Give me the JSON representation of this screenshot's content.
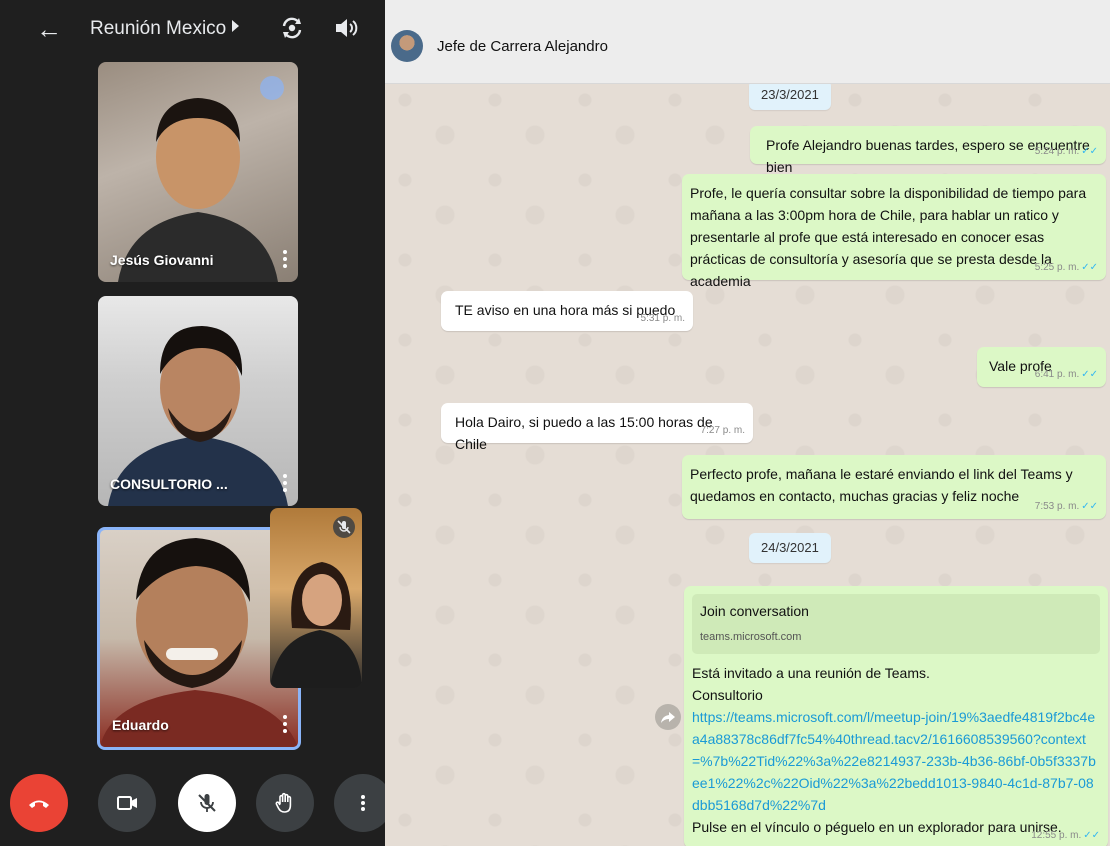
{
  "call": {
    "back_icon": "arrow-left-icon",
    "title": "Reunión Mexico",
    "participants": [
      {
        "name": "Jesús Giovanni"
      },
      {
        "name": "CONSULTORIO ..."
      },
      {
        "name": "Eduardo"
      }
    ],
    "controls": [
      "end-call-icon",
      "camera-icon",
      "mic-off-icon",
      "raise-hand-icon",
      "more-vert-icon"
    ],
    "colors": {
      "background": "#1f1f1f",
      "end_call": "#ea4335",
      "active_tile": "#8ab4f8"
    }
  },
  "chat": {
    "contact": "Jefe de Carrera Alejandro",
    "dates": [
      "23/3/2021",
      "24/3/2021"
    ],
    "messages": [
      {
        "dir": "out",
        "text": "Profe Alejandro buenas tardes, espero se encuentre bien",
        "time": "5:24 p. m."
      },
      {
        "dir": "out",
        "text": "Profe, le quería consultar sobre la disponibilidad de tiempo para mañana a las 3:00pm hora de Chile, para hablar un ratico y presentarle al profe que está interesado en conocer esas prácticas de consultoría y asesoría que se presta desde la academia",
        "time": "5:25 p. m."
      },
      {
        "dir": "in",
        "text": "TE aviso en una hora más si puedo",
        "time": "5:31 p. m."
      },
      {
        "dir": "out",
        "text": "Vale profe",
        "time": "6:41 p. m."
      },
      {
        "dir": "in",
        "text": "Hola Dairo, si puedo a las 15:00 horas de Chile",
        "time": "7:27 p. m."
      },
      {
        "dir": "out",
        "text": "Perfecto profe, mañana le estaré enviando el link del Teams y quedamos en contacto, muchas gracias y feliz noche",
        "time": "7:53 p. m."
      }
    ],
    "link_message": {
      "card_title": "Join conversation",
      "card_domain": "teams.microsoft.com",
      "line1": "Está invitado a una reunión de Teams.",
      "line2": "Consultorio",
      "url": "https://teams.microsoft.com/l/meetup-join/19%3aedfe4819f2bc4ea4a88378c86df7fc54%40thread.tacv2/1616608539560?context=%7b%22Tid%22%3a%22e8214937-233b-4b36-86bf-0b5f3337bee1%22%2c%22Oid%22%3a%22bedd1013-9840-4c1d-87b7-08dbb5168d7d%22%7d",
      "line3": "Pulse en el vínculo o péguelo en un explorador para unirse.",
      "time": "12:55 p. m."
    },
    "colors": {
      "background": "#e5ddd5",
      "outgoing": "#dcf8c6",
      "incoming": "#ffffff",
      "date_chip": "#e1f2fb",
      "read_ticks": "#34b7f1",
      "link": "#1a9ad6"
    }
  }
}
